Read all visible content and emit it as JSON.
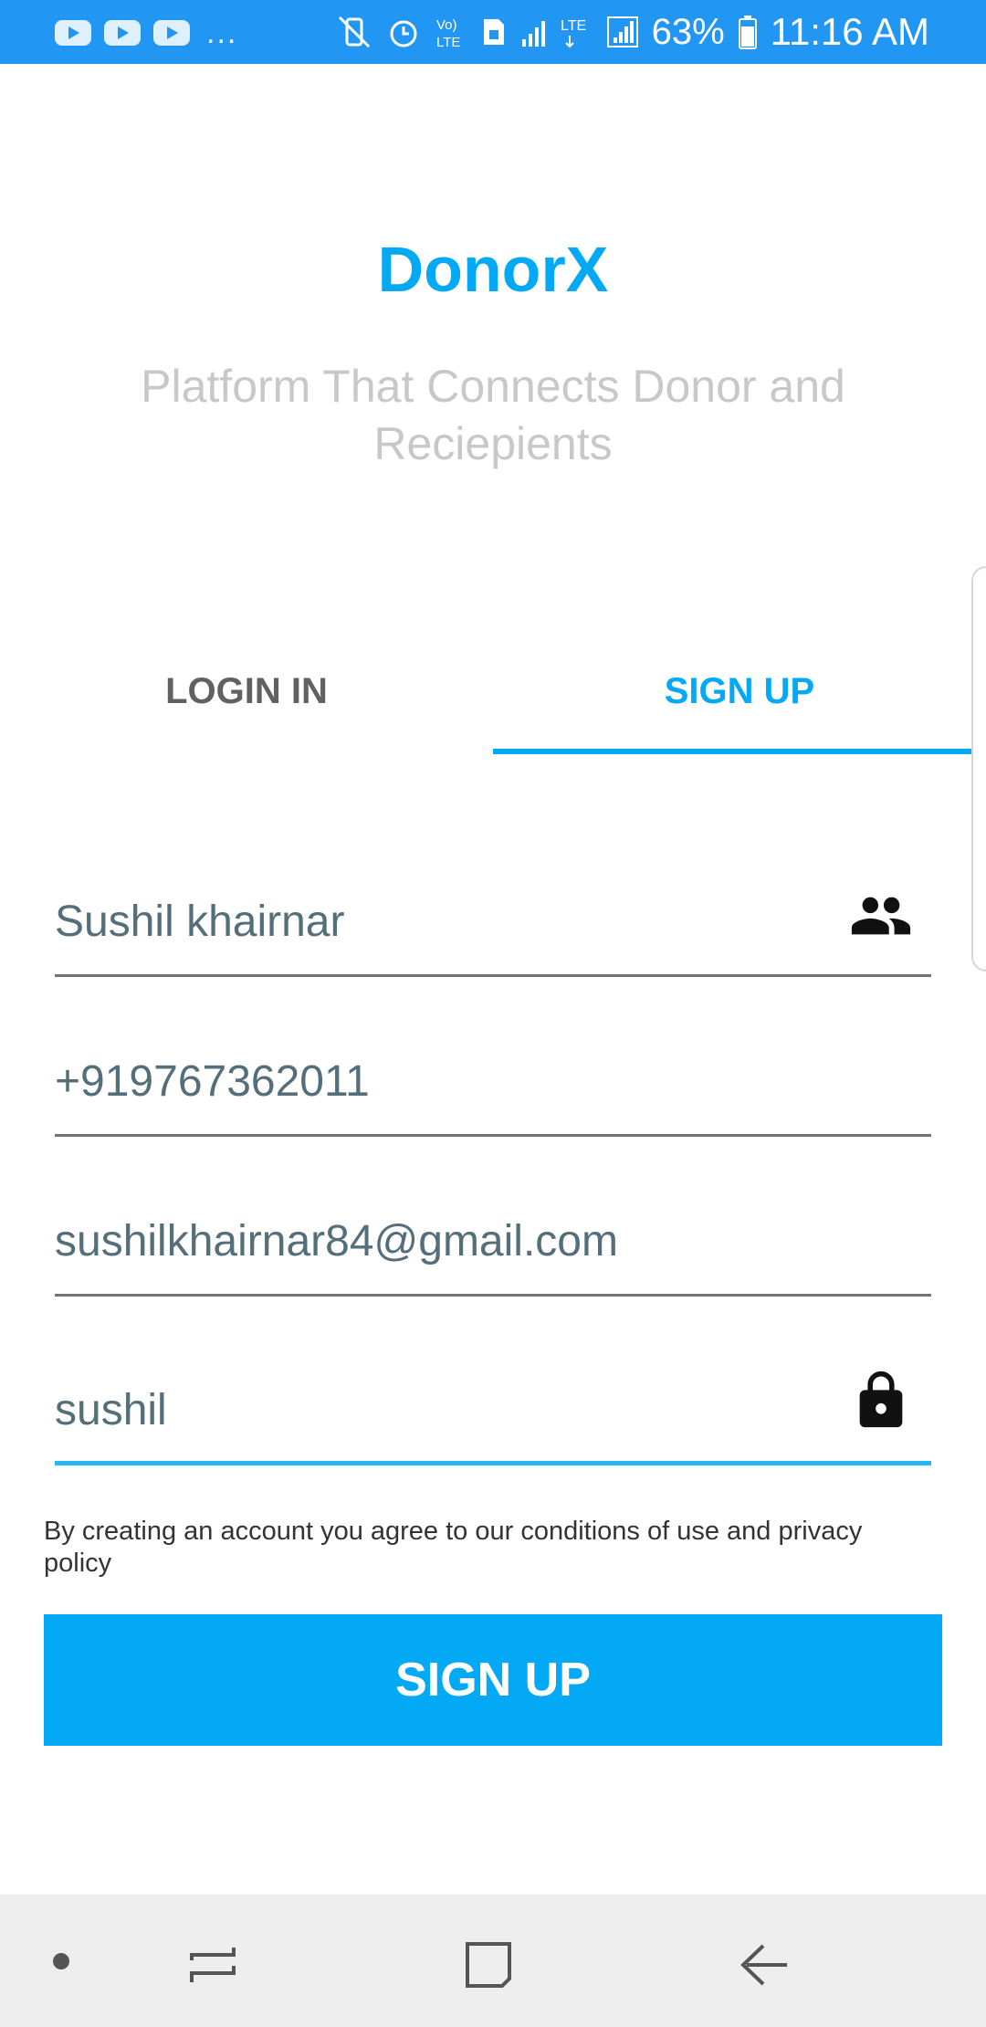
{
  "status_bar": {
    "battery": "63%",
    "time": "11:16 AM",
    "more_indicator": "...",
    "notification_icons": [
      "youtube-icon",
      "youtube-icon",
      "youtube-icon"
    ],
    "system_icons": [
      "vibrate-mute-icon",
      "alarm-icon",
      "volte-icon",
      "sim-icon",
      "signal-icon",
      "lte-icon",
      "signal-icon",
      "battery-icon"
    ]
  },
  "header": {
    "title": "DonorX",
    "subtitle": "Platform That Connects Donor and Reciepients"
  },
  "tabs": [
    {
      "label": "LOGIN IN",
      "selected": false
    },
    {
      "label": "SIGN UP",
      "selected": true
    }
  ],
  "form": {
    "name": {
      "value": "Sushil khairnar",
      "icon": "people-icon"
    },
    "phone": {
      "value": "+919767362011"
    },
    "email": {
      "value": "sushilkhairnar84@gmail.com"
    },
    "password": {
      "value": "sushil",
      "icon": "lock-icon"
    },
    "terms": "By creating an account you agree to our conditions of use and privacy policy",
    "submit_label": "SIGN UP"
  },
  "nav_bar": {
    "buttons": [
      "dot-indicator",
      "recents-icon",
      "home-icon",
      "back-icon"
    ]
  },
  "colors": {
    "status_bar": "#2196f3",
    "accent": "#03a9f4",
    "subtitle": "#c8c8c8",
    "input_text": "#546e7a"
  }
}
